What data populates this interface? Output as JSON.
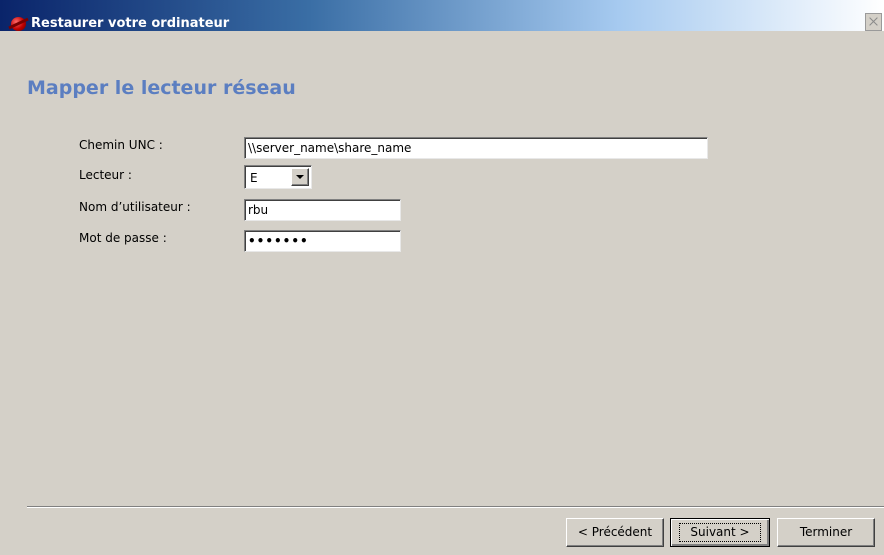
{
  "window": {
    "title": "Restaurer votre ordinateur",
    "icon": "restore-app-icon"
  },
  "page": {
    "title": "Mapper le lecteur réseau"
  },
  "form": {
    "unc_label": "Chemin UNC :",
    "unc_value": "\\\\server_name\\share_name",
    "drive_label": "Lecteur :",
    "drive_value": "E",
    "user_label": "Nom d’utilisateur :",
    "user_value": "rbu",
    "password_label": "Mot de passe :",
    "password_value": "•••••••"
  },
  "buttons": {
    "previous": "< Précédent",
    "next": "Suivant >",
    "finish": "Terminer"
  }
}
